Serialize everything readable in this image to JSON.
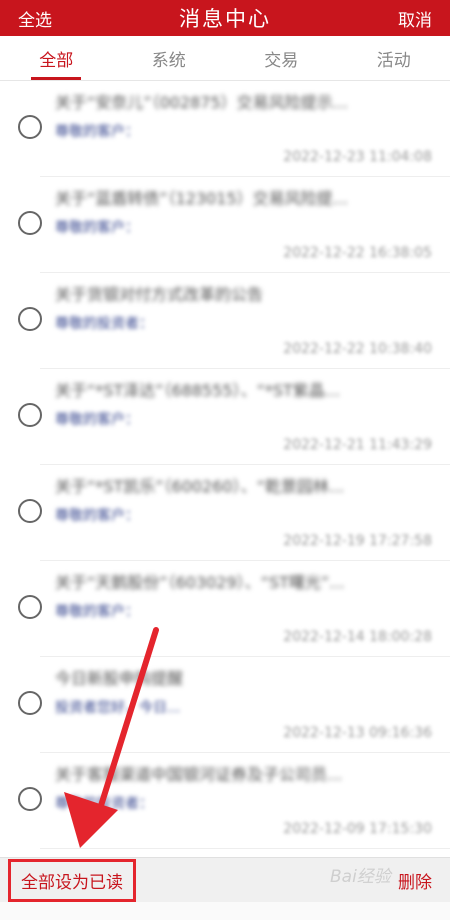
{
  "header": {
    "select_all": "全选",
    "title": "消息中心",
    "cancel": "取消"
  },
  "tabs": [
    {
      "label": "全部",
      "active": true
    },
    {
      "label": "系统",
      "active": false
    },
    {
      "label": "交易",
      "active": false
    },
    {
      "label": "活动",
      "active": false
    }
  ],
  "messages": [
    {
      "title": "关于“安奈儿”（002875）交易风险提示...",
      "subtitle": "尊敬的客户：",
      "date": "2022-12-23 11:04:08"
    },
    {
      "title": "关于“蓝盾转债”（123015）交易风险提...",
      "subtitle": "尊敬的客户：",
      "date": "2022-12-22 16:38:05"
    },
    {
      "title": "关于货银对付方式改革的公告",
      "subtitle": "尊敬的投资者：",
      "date": "2022-12-22 10:38:40"
    },
    {
      "title": "关于“*ST泽达”（688555）、“*ST紫晶...",
      "subtitle": "尊敬的客户：",
      "date": "2022-12-21 11:43:29"
    },
    {
      "title": "关于“*ST凯乐”（600260）、“乾景园林...",
      "subtitle": "尊敬的客户：",
      "date": "2022-12-19 17:27:58"
    },
    {
      "title": "关于“天鹅股份”（603029）、“ST曙光”...",
      "subtitle": "尊敬的客户：",
      "date": "2022-12-14 18:00:28"
    },
    {
      "title": "今日新股申购提醒",
      "subtitle": "投资者您好，今日...",
      "date": "2022-12-13 09:16:36"
    },
    {
      "title": "关于客服渠道中国银河证券及子公司员...",
      "subtitle": "尊敬的投资者：",
      "date": "2022-12-09 17:15:30"
    }
  ],
  "footer": {
    "mark_all_read": "全部设为已读",
    "delete": "删除"
  },
  "watermark": "Bai经验",
  "colors": {
    "brand": "#c8151d",
    "annotation": "#e4252d"
  }
}
